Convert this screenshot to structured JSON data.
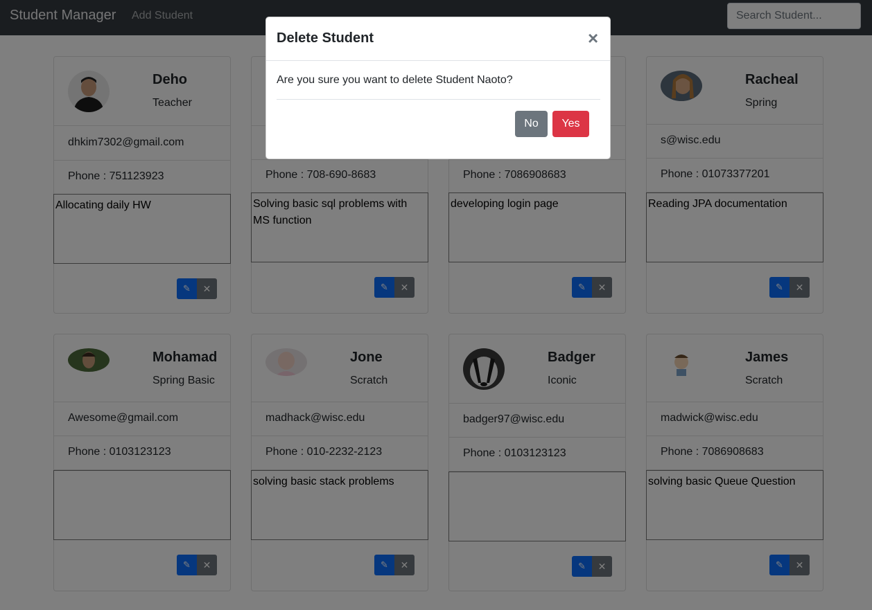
{
  "navbar": {
    "brand": "Student Manager",
    "add_student": "Add Student",
    "search_placeholder": "Search Student..."
  },
  "students": [
    {
      "name": "Deho",
      "course": "Teacher",
      "email": "dhkim7302@gmail.com",
      "phone": "Phone : 751123923",
      "notes": "Allocating daily HW"
    },
    {
      "name": "",
      "course": "",
      "email": "",
      "phone": "Phone : 708-690-8683",
      "notes": "Solving basic sql problems with MS function"
    },
    {
      "name": "",
      "course": "",
      "email": "",
      "phone": "Phone : 7086908683",
      "notes": "developing login page"
    },
    {
      "name": "Racheal",
      "course": "Spring",
      "email": "s@wisc.edu",
      "phone": "Phone : 01073377201",
      "notes": "Reading JPA documentation"
    },
    {
      "name": "Mohamad",
      "course": "Spring Basic",
      "email": "Awesome@gmail.com",
      "phone": "Phone : 0103123123",
      "notes": ""
    },
    {
      "name": "Jone",
      "course": "Scratch",
      "email": "madhack@wisc.edu",
      "phone": "Phone : 010-2232-2123",
      "notes": "solving basic stack problems"
    },
    {
      "name": "Badger",
      "course": "Iconic",
      "email": "badger97@wisc.edu",
      "phone": "Phone : 0103123123",
      "notes": ""
    },
    {
      "name": "James",
      "course": "Scratch",
      "email": "madwick@wisc.edu",
      "phone": "Phone : 7086908683",
      "notes": "solving basic Queue Question"
    }
  ],
  "icons": {
    "edit": "pencil-icon",
    "delete": "x-icon"
  },
  "modal": {
    "title": "Delete Student",
    "close": "×",
    "body": "Are you sure you want to delete Student Naoto?",
    "no": "No",
    "yes": "Yes"
  },
  "colors": {
    "navbar": "#343a40",
    "primary": "#0d6efd",
    "secondary": "#6c757d",
    "danger": "#dc3545"
  }
}
